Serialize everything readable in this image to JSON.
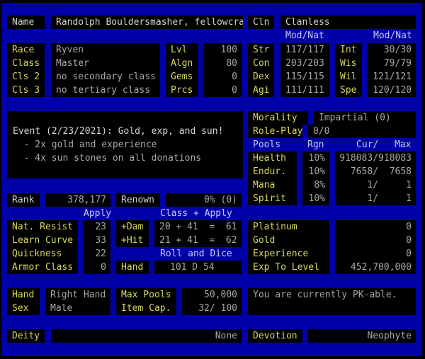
{
  "header": {
    "name_label": "Name",
    "name_value": "Randolph Bouldersmasher, fellowcra",
    "clan_label": "Cln",
    "clan_value": "Clanless"
  },
  "stat_headers": {
    "left": "Mod/Nat",
    "right": "Mod/Nat"
  },
  "info_rows": [
    {
      "label": "Race",
      "value": "Ryven",
      "k": "Lvl",
      "v": "100"
    },
    {
      "label": "Class",
      "value": "Master",
      "k": "Algn",
      "v": "80"
    },
    {
      "label": "Cls 2",
      "value": "no secondary class",
      "k": "Gems",
      "v": "0"
    },
    {
      "label": "Cls 3",
      "value": "no tertiary class",
      "k": "Prcs",
      "v": "0"
    }
  ],
  "stats": [
    {
      "a": "Str",
      "av": "117/117",
      "b": "Int",
      "bv": "30/30"
    },
    {
      "a": "Con",
      "av": "203/203",
      "b": "Wis",
      "bv": "79/79"
    },
    {
      "a": "Dex",
      "av": "115/115",
      "b": "Wil",
      "bv": "121/121"
    },
    {
      "a": "Agi",
      "av": "111/111",
      "b": "Spe",
      "bv": "120/120"
    }
  ],
  "event": {
    "title": "Event (2/23/2021): Gold, exp, and sun!",
    "lines": [
      "  - 2x gold and experience",
      "  - 4x sun stones on all donations"
    ]
  },
  "morality": {
    "label": "Morality",
    "value": "Impartial (0)"
  },
  "roleplay": {
    "label": "Role-Play",
    "value": "0/0"
  },
  "pools_header": {
    "pools": "Pools",
    "rgn": "Rgn",
    "cur": "Cur/",
    "max": "Max"
  },
  "pools": [
    {
      "label": "Health",
      "rgn": "10%",
      "value": "918083/918083"
    },
    {
      "label": "Endur.",
      "rgn": "10%",
      "value": "7658/  7658"
    },
    {
      "label": "Mana",
      "rgn": "8%",
      "value": "1/     1"
    },
    {
      "label": "Spirit",
      "rgn": "10%",
      "value": "1/     1"
    }
  ],
  "rank": {
    "label": "Rank",
    "value": "378,177",
    "renown_label": "Renown",
    "renown_value": "0% (0)"
  },
  "apply_header": {
    "apply": "Apply",
    "class_apply": "Class + Apply",
    "roll_dice": "Roll and Dice"
  },
  "attributes": [
    {
      "label": "Nat. Resist",
      "value": "23"
    },
    {
      "label": "Learn Curve",
      "value": "33"
    },
    {
      "label": "Quickness",
      "value": "22"
    },
    {
      "label": "Armor Class",
      "value": "0"
    }
  ],
  "combat": {
    "dam_label": "+Dam",
    "dam_value": "20 + 41  =  61",
    "hit_label": "+Hit",
    "hit_value": "21 + 41  =  62",
    "hand_label": "Hand",
    "hand_value": "101 D 54"
  },
  "currency": [
    {
      "label": "Platinum",
      "value": "0"
    },
    {
      "label": "Gold",
      "value": "0"
    },
    {
      "label": "Experience",
      "value": "0"
    },
    {
      "label": "Exp To Level",
      "value": "452,700,000"
    }
  ],
  "misc": {
    "hand_label": "Hand",
    "hand_value": "Right Hand",
    "sex_label": "Sex",
    "sex_value": "Male",
    "maxpools_label": "Max Pools",
    "maxpools_value": "50,000",
    "itemcap_label": "Item Cap.",
    "itemcap_value": "32/ 100",
    "pk_status": "You are currently PK-able."
  },
  "deity": {
    "label": "Deity",
    "value": "None",
    "devotion_label": "Devotion",
    "devotion_value": "Neophyte"
  }
}
